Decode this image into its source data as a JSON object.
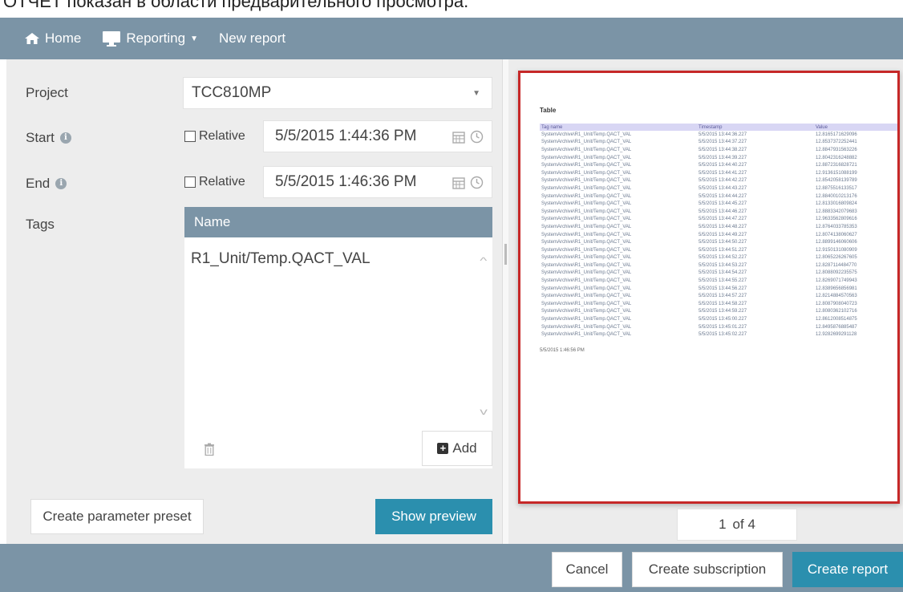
{
  "caption": "ОТЧЕТ показан в области предварительного просмотра.",
  "nav": {
    "home": "Home",
    "reporting": "Reporting",
    "new_report": "New report"
  },
  "form": {
    "project_label": "Project",
    "project_value": "TCC810MP",
    "start_label": "Start",
    "end_label": "End",
    "relative_label": "Relative",
    "start_value": "5/5/2015 1:44:36 PM",
    "end_value": "5/5/2015 1:46:36 PM",
    "tags_label": "Tags",
    "tags_column": "Name",
    "tags": [
      "R1_Unit/Temp.QACT_VAL"
    ],
    "add_label": "Add",
    "preset_label": "Create parameter preset",
    "preview_label": "Show preview"
  },
  "preview": {
    "doc_title": "Table",
    "columns": [
      "Tag name",
      "Timestamp",
      "Value"
    ],
    "rows": [
      [
        "SystemArchive\\R1_Unit/Temp.QACT_VAL",
        "5/5/2015 13:44:36.227",
        "12.8165171629096"
      ],
      [
        "SystemArchive\\R1_Unit/Temp.QACT_VAL",
        "5/5/2015 13:44:37.227",
        "12.8537372252441"
      ],
      [
        "SystemArchive\\R1_Unit/Temp.QACT_VAL",
        "5/5/2015 13:44:38.227",
        "12.8847931563226"
      ],
      [
        "SystemArchive\\R1_Unit/Temp.QACT_VAL",
        "5/5/2015 13:44:39.227",
        "12.8042316248882"
      ],
      [
        "SystemArchive\\R1_Unit/Temp.QACT_VAL",
        "5/5/2015 13:44:40.227",
        "12.8872316828721"
      ],
      [
        "SystemArchive\\R1_Unit/Temp.QACT_VAL",
        "5/5/2015 13:44:41.227",
        "12.9136151088199"
      ],
      [
        "SystemArchive\\R1_Unit/Temp.QACT_VAL",
        "5/5/2015 13:44:42.227",
        "12.8542058139789"
      ],
      [
        "SystemArchive\\R1_Unit/Temp.QACT_VAL",
        "5/5/2015 13:44:43.227",
        "12.8875516133517"
      ],
      [
        "SystemArchive\\R1_Unit/Temp.QACT_VAL",
        "5/5/2015 13:44:44.227",
        "12.8840010213176"
      ],
      [
        "SystemArchive\\R1_Unit/Temp.QACT_VAL",
        "5/5/2015 13:44:45.227",
        "12.8133016809824"
      ],
      [
        "SystemArchive\\R1_Unit/Temp.QACT_VAL",
        "5/5/2015 13:44:46.227",
        "12.8883342079683"
      ],
      [
        "SystemArchive\\R1_Unit/Temp.QACT_VAL",
        "5/5/2015 13:44:47.227",
        "12.9633562809616"
      ],
      [
        "SystemArchive\\R1_Unit/Temp.QACT_VAL",
        "5/5/2015 13:44:48.227",
        "12.8764033785353"
      ],
      [
        "SystemArchive\\R1_Unit/Temp.QACT_VAL",
        "5/5/2015 13:44:49.227",
        "12.8074138060627"
      ],
      [
        "SystemArchive\\R1_Unit/Temp.QACT_VAL",
        "5/5/2015 13:44:50.227",
        "12.8899146060606"
      ],
      [
        "SystemArchive\\R1_Unit/Temp.QACT_VAL",
        "5/5/2015 13:44:51.227",
        "12.9150131080909"
      ],
      [
        "SystemArchive\\R1_Unit/Temp.QACT_VAL",
        "5/5/2015 13:44:52.227",
        "12.8065226267605"
      ],
      [
        "SystemArchive\\R1_Unit/Temp.QACT_VAL",
        "5/5/2015 13:44:53.227",
        "12.8287114484770"
      ],
      [
        "SystemArchive\\R1_Unit/Temp.QACT_VAL",
        "5/5/2015 13:44:54.227",
        "12.8088092235575"
      ],
      [
        "SystemArchive\\R1_Unit/Temp.QACT_VAL",
        "5/5/2015 13:44:55.227",
        "12.8269071749943"
      ],
      [
        "SystemArchive\\R1_Unit/Temp.QACT_VAL",
        "5/5/2015 13:44:56.227",
        "12.8389656856981"
      ],
      [
        "SystemArchive\\R1_Unit/Temp.QACT_VAL",
        "5/5/2015 13:44:57.227",
        "12.8214884570563"
      ],
      [
        "SystemArchive\\R1_Unit/Temp.QACT_VAL",
        "5/5/2015 13:44:58.227",
        "12.8087908040723"
      ],
      [
        "SystemArchive\\R1_Unit/Temp.QACT_VAL",
        "5/5/2015 13:44:59.227",
        "12.8080362102716"
      ],
      [
        "SystemArchive\\R1_Unit/Temp.QACT_VAL",
        "5/5/2015 13:45:00.227",
        "12.8612008514875"
      ],
      [
        "SystemArchive\\R1_Unit/Temp.QACT_VAL",
        "5/5/2015 13:45:01.227",
        "12.8495876885487"
      ],
      [
        "SystemArchive\\R1_Unit/Temp.QACT_VAL",
        "5/5/2015 13:45:02.227",
        "12.9282699291128"
      ]
    ],
    "footer": "5/5/2015 1:46:56 PM",
    "page_current": "1",
    "page_total": "of 4"
  },
  "footer_actions": {
    "cancel": "Cancel",
    "subscription": "Create subscription",
    "create": "Create report"
  },
  "colors": {
    "bar": "#7b94a6",
    "primary_button": "#2b8fae",
    "preview_border": "#c62828"
  },
  "icons": {
    "home": "home-icon",
    "reporting": "monitor-icon",
    "info": "info-icon",
    "calendar": "calendar-icon",
    "clock": "clock-icon",
    "trash": "trash-icon",
    "add": "plus-square-icon"
  }
}
